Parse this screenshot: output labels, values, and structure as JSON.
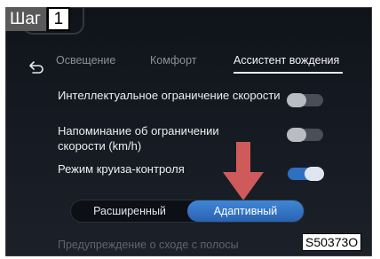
{
  "step": {
    "word": "Шаг",
    "number": "1"
  },
  "tabs": [
    {
      "label": "Освещение",
      "active": false
    },
    {
      "label": "Комфорт",
      "active": false
    },
    {
      "label": "Ассистент вождения",
      "active": true
    }
  ],
  "icons": {
    "back": "back-arrow-icon",
    "pointer": "red-down-arrow-icon"
  },
  "rows": [
    {
      "label": "Интеллектуальное ограничение скорости",
      "toggle": "off"
    },
    {
      "label_line1": "Напоминание об ограничении",
      "label_line2": "скорости (km/h)",
      "toggle": "off"
    },
    {
      "label": "Режим круиза-контроля",
      "toggle": "on"
    }
  ],
  "cruise_mode": {
    "options": [
      "Расширенный",
      "Адаптивный"
    ],
    "selected": "Адаптивный"
  },
  "faded_row": "Предупреждение о сходе с полосы",
  "figure_code": "S50373O",
  "colors": {
    "accent": "#2f6fc2",
    "pointer_arrow": "#e06060",
    "background": "#151a22"
  }
}
